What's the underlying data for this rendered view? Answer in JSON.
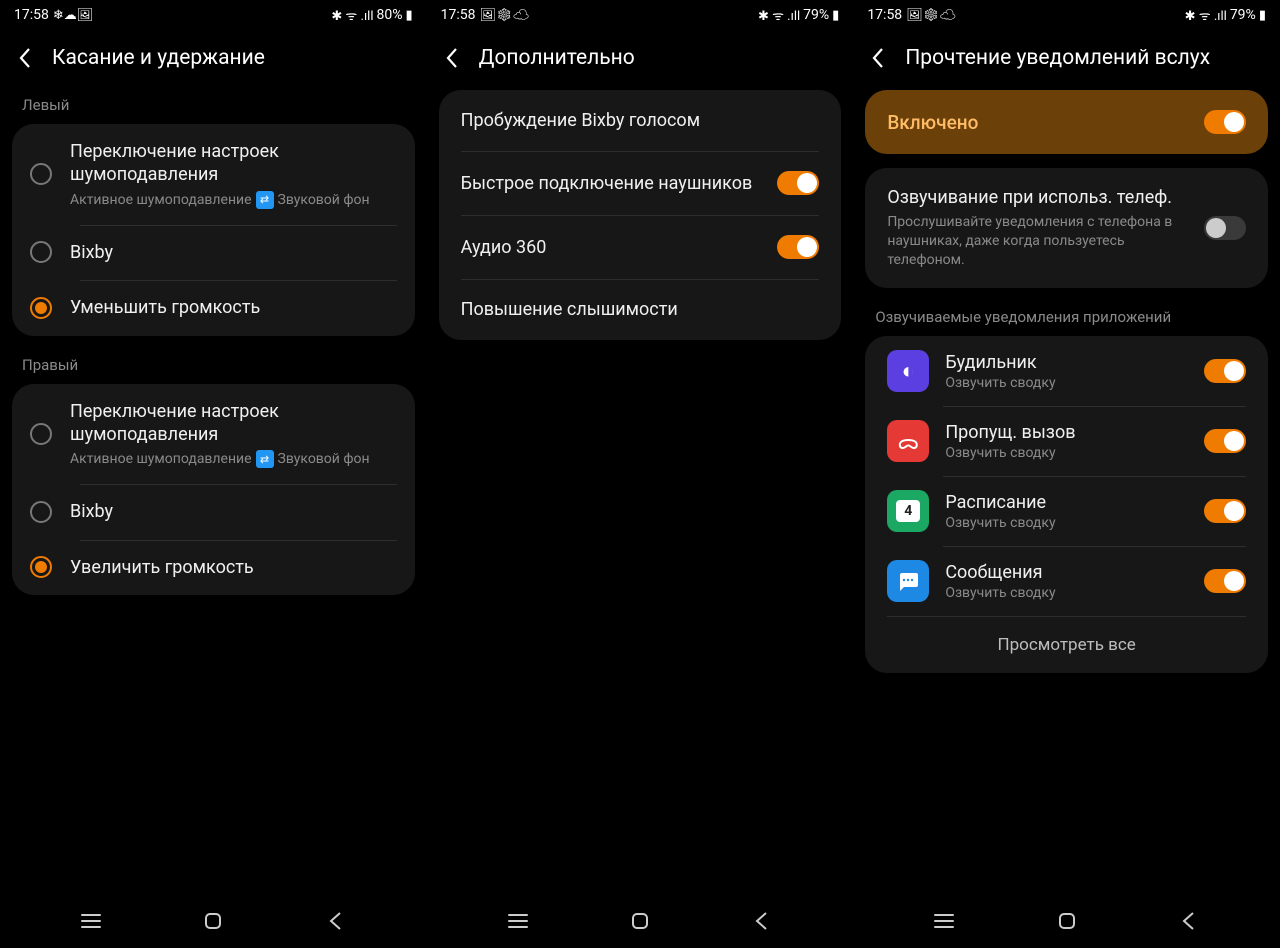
{
  "screens": [
    {
      "status": {
        "time": "17:58",
        "icons_left": "❄☁🖼",
        "icons_right": "✱ ᯤ .ıll",
        "battery": "80%",
        "batt_icon": "▮"
      },
      "title": "Касание и удержание",
      "groups": [
        {
          "label": "Левый",
          "options": [
            {
              "title": "Переключение настроек шумоподавления",
              "sub_pre": "Активное шумоподавление",
              "sub_post": "Звуковой фон",
              "checked": false,
              "swap": true
            },
            {
              "title": "Bixby",
              "checked": false
            },
            {
              "title": "Уменьшить громкость",
              "checked": true
            }
          ]
        },
        {
          "label": "Правый",
          "options": [
            {
              "title": "Переключение настроек шумоподавления",
              "sub_pre": "Активное шумоподавление",
              "sub_post": "Звуковой фон",
              "checked": false,
              "swap": true
            },
            {
              "title": "Bixby",
              "checked": false
            },
            {
              "title": "Увеличить громкость",
              "checked": true
            }
          ]
        }
      ]
    },
    {
      "status": {
        "time": "17:58",
        "icons_left": "🖼❄☁",
        "icons_right": "✱ ᯤ .ıll",
        "battery": "79%",
        "batt_icon": "▮"
      },
      "title": "Дополнительно",
      "rows": [
        {
          "title": "Пробуждение Bixby голосом",
          "toggle": null
        },
        {
          "title": "Быстрое подключение наушников",
          "toggle": true
        },
        {
          "title": "Аудио 360",
          "toggle": true
        },
        {
          "title": "Повышение слышимости",
          "toggle": null
        }
      ]
    },
    {
      "status": {
        "time": "17:58",
        "icons_left": "🖼❄☁",
        "icons_right": "✱ ᯤ .ıll",
        "battery": "79%",
        "batt_icon": "▮"
      },
      "title": "Прочтение уведомлений вслух",
      "master": {
        "label": "Включено",
        "on": true
      },
      "setting": {
        "title": "Озвучивание при использ. телеф.",
        "sub": "Прослушивайте уведомления с телефона в наушниках, даже когда пользуетесь телефоном.",
        "on": false
      },
      "apps_label": "Озвучиваемые уведомления приложений",
      "apps": [
        {
          "title": "Будильник",
          "sub": "Озвучить сводку",
          "color": "#5b3fe0",
          "glyph": "◐",
          "on": true
        },
        {
          "title": "Пропущ. вызов",
          "sub": "Озвучить сводку",
          "color": "#e53935",
          "glyph": "ᯅ",
          "on": true
        },
        {
          "title": "Расписание",
          "sub": "Озвучить сводку",
          "color": "#1aa863",
          "glyph": "4",
          "on": true
        },
        {
          "title": "Сообщения",
          "sub": "Озвучить сводку",
          "color": "#1e88e5",
          "glyph": "⋯",
          "on": true
        }
      ],
      "view_all": "Просмотреть все"
    }
  ]
}
